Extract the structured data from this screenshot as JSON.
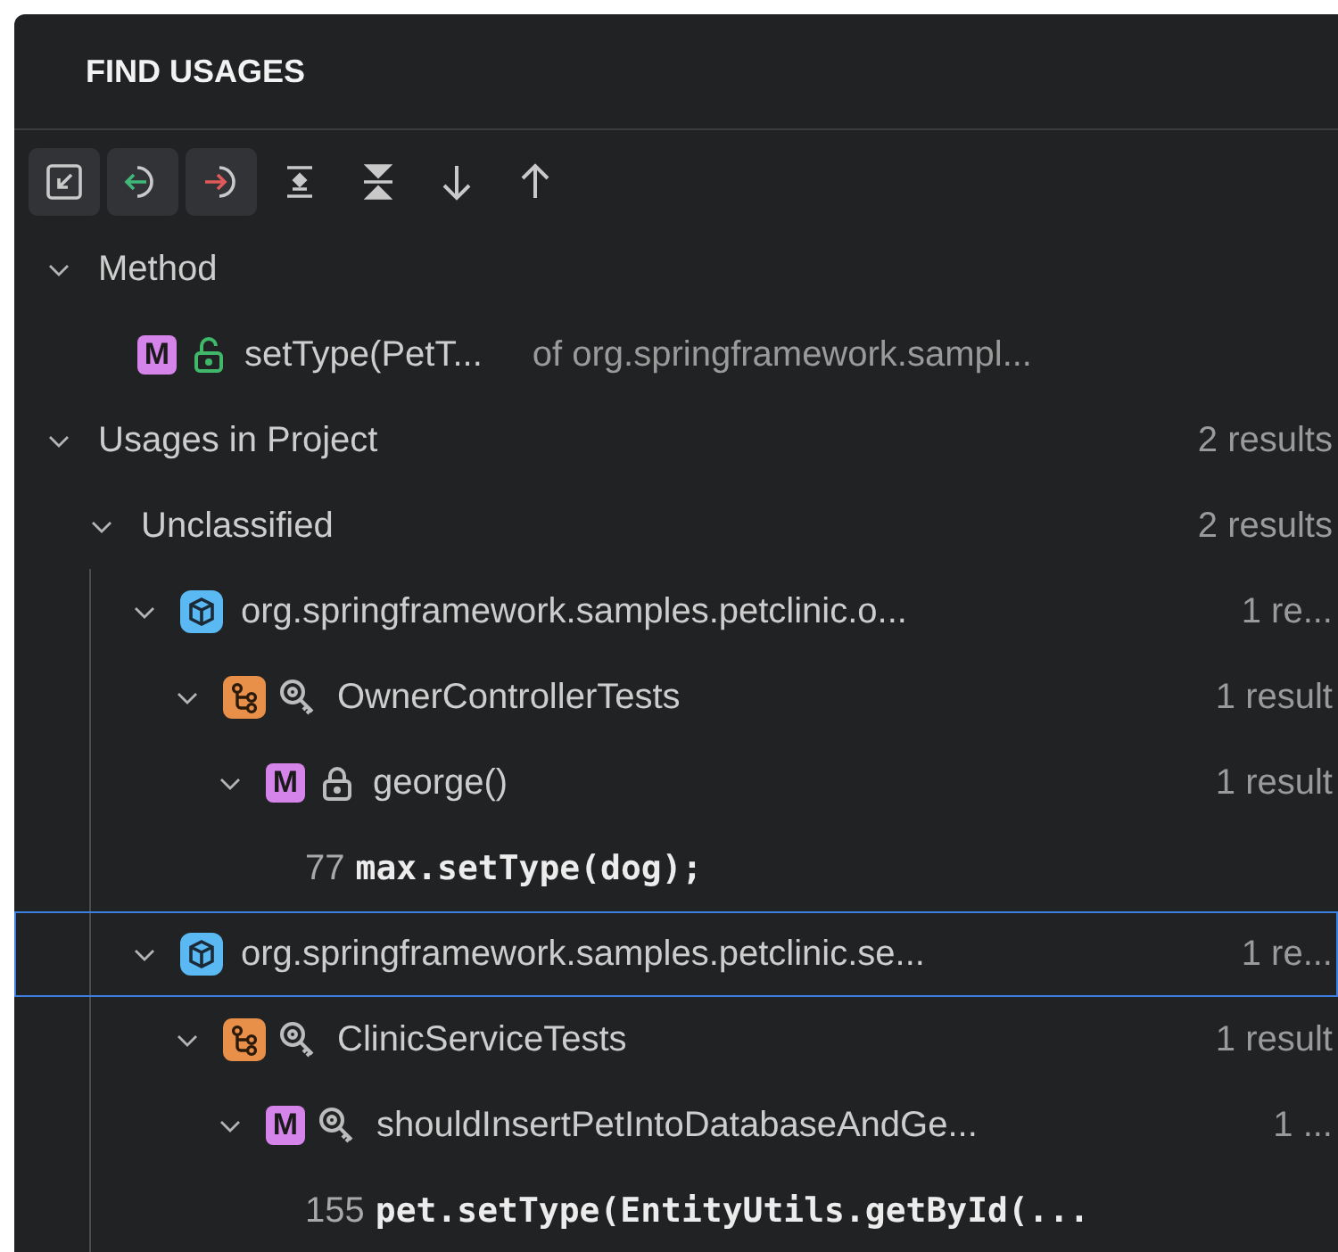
{
  "panel": {
    "title": "FIND USAGES"
  },
  "toolbar": [
    {
      "pressed": true
    },
    {
      "pressed": true
    },
    {
      "pressed": true
    },
    {
      "pressed": false
    },
    {
      "pressed": false
    },
    {
      "pressed": false
    },
    {
      "pressed": false
    }
  ],
  "tree": [
    {
      "kind": "group",
      "label": "Method",
      "expanded": true,
      "selected": false,
      "children": [
        {
          "kind": "method",
          "badge": "M",
          "marker": {
            "kind": "unlocked"
          },
          "label": "setType(PetT...",
          "detail": "of org.springframework.sampl...",
          "selected": false
        }
      ]
    },
    {
      "kind": "group",
      "label": "Usages in Project",
      "count": "2 results",
      "expanded": true,
      "selected": false,
      "children": [
        {
          "kind": "group",
          "label": "Unclassified",
          "count": "2 results",
          "expanded": true,
          "selected": false,
          "children": [
            {
              "kind": "package",
              "label": "org.springframework.samples.petclinic.o...",
              "count": "1 re...",
              "expanded": true,
              "selected": false,
              "children": [
                {
                  "kind": "class",
                  "marker": {
                    "kind": "search"
                  },
                  "label": "OwnerControllerTests",
                  "count": "1 result",
                  "expanded": true,
                  "selected": false,
                  "children": [
                    {
                      "kind": "method",
                      "badge": "M",
                      "marker": {
                        "kind": "locked"
                      },
                      "label": "george()",
                      "count": "1 result",
                      "expanded": true,
                      "selected": false,
                      "children": [
                        {
                          "kind": "line",
                          "number": "77",
                          "code": "max.setType(dog);",
                          "selected": false
                        }
                      ]
                    }
                  ]
                }
              ]
            },
            {
              "kind": "package",
              "label": "org.springframework.samples.petclinic.se...",
              "count": "1 re...",
              "expanded": true,
              "selected": true,
              "children": [
                {
                  "kind": "class",
                  "marker": {
                    "kind": "search"
                  },
                  "label": "ClinicServiceTests",
                  "count": "1 result",
                  "expanded": true,
                  "selected": false,
                  "children": [
                    {
                      "kind": "method",
                      "badge": "M",
                      "marker": {
                        "kind": "search"
                      },
                      "label": "shouldInsertPetIntoDatabaseAndGe...",
                      "count": "1 ...",
                      "expanded": true,
                      "selected": false,
                      "children": [
                        {
                          "kind": "line",
                          "number": "155",
                          "code": "pet.setType(EntityUtils.getById(...",
                          "selected": false
                        }
                      ]
                    }
                  ]
                }
              ]
            }
          ]
        }
      ]
    }
  ]
}
